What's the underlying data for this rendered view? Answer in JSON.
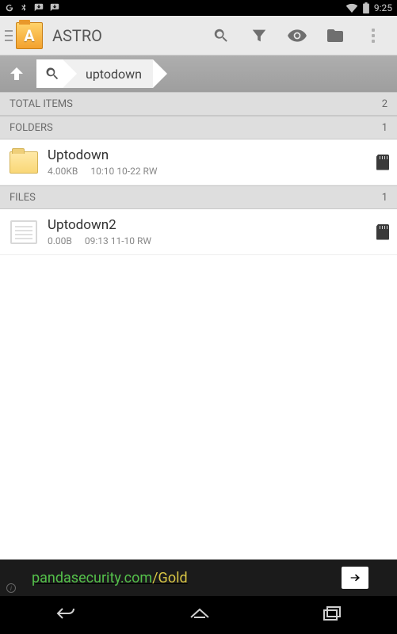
{
  "status": {
    "time": "9:25"
  },
  "app": {
    "title": "ASTRO",
    "icon_letter": "A"
  },
  "path": {
    "current": "uptodown"
  },
  "sections": {
    "total": {
      "label": "TOTAL ITEMS",
      "count": "2"
    },
    "folders": {
      "label": "FOLDERS",
      "count": "1"
    },
    "files": {
      "label": "FILES",
      "count": "1"
    }
  },
  "folders": [
    {
      "name": "Uptodown",
      "size": "4.00KB",
      "date": "10:10 10-22 RW"
    }
  ],
  "files": [
    {
      "name": "Uptodown2",
      "size": "0.00B",
      "date": "09:13 11-10 RW"
    }
  ],
  "ad": {
    "part1": "pandasecurity.com",
    "part2": "/Gold"
  }
}
